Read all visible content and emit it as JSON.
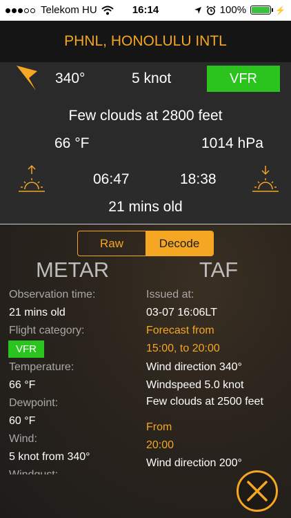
{
  "status_bar": {
    "carrier": "Telekom HU",
    "time": "16:14",
    "battery": "100%"
  },
  "header": {
    "title": "PHNL, HONOLULU INTL"
  },
  "summary": {
    "wind_direction": "340°",
    "wind_speed": "5 knot",
    "category": "VFR",
    "clouds": "Few clouds at 2800 feet",
    "temperature": "66 °F",
    "pressure": "1014 hPa",
    "sunrise": "06:47",
    "sunset": "18:38",
    "age": "21 mins old"
  },
  "segment": {
    "raw_label": "Raw",
    "decode_label": "Decode",
    "selected": "Decode"
  },
  "metar": {
    "title": "METAR",
    "obs_time_label": "Observation time:",
    "obs_time_value": "21 mins old",
    "flight_category_label": "Flight category:",
    "flight_category_value": "VFR",
    "temperature_label": "Temperature:",
    "temperature_value": "66 °F",
    "dewpoint_label": "Dewpoint:",
    "dewpoint_value": "60 °F",
    "wind_label": "Wind:",
    "wind_value": "5 knot from 340°",
    "windgust_label": "Windgust:"
  },
  "taf": {
    "title": "TAF",
    "issued_label": "Issued at:",
    "issued_value": "03-07 16:06LT",
    "forecast_from_label": "Forecast from",
    "forecast_range": "15:00, to 20:00",
    "wind_direction_1": "Wind direction 340°",
    "windspeed_1": "Windspeed 5.0 knot",
    "clouds_1": "Few clouds at 2500 feet",
    "from_label": "From",
    "from_time": "20:00",
    "wind_direction_2": "Wind direction 200°"
  },
  "colors": {
    "accent": "#f5a623",
    "vfr_green": "#2bc41f",
    "background": "#1d1d1d"
  },
  "icons": [
    "wind-direction-arrow-icon",
    "sunrise-icon",
    "sunset-icon",
    "close-icon",
    "wifi-icon",
    "location-arrow-icon",
    "alarm-icon",
    "battery-icon"
  ]
}
